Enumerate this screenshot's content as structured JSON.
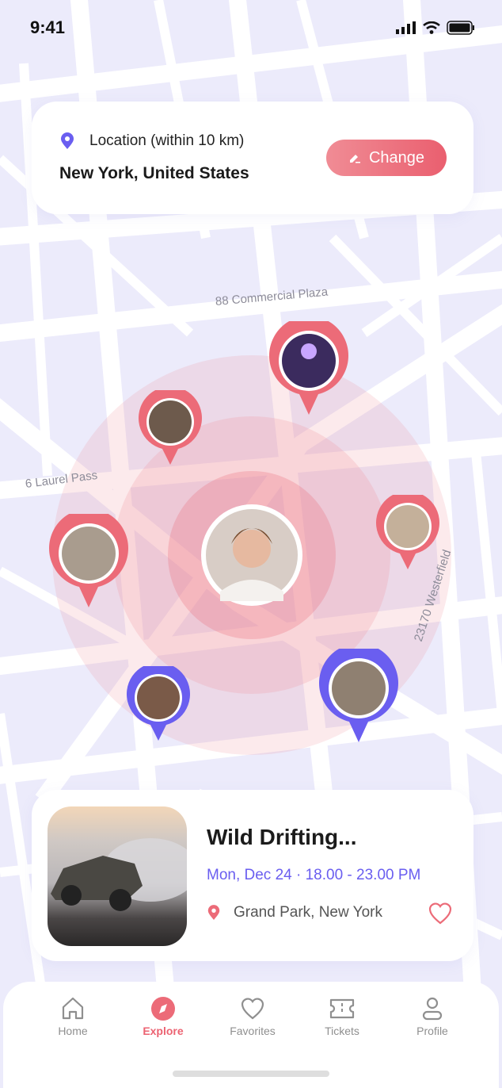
{
  "status_bar": {
    "time": "9:41"
  },
  "location": {
    "label": "Location (within 10 km)",
    "value": "New York, United States",
    "change_label": "Change"
  },
  "map": {
    "streets": [
      "88 Commercial Plaza",
      "6 Laurel Pass",
      "23170 Westerfield"
    ],
    "radius_km": 10
  },
  "event": {
    "title": "Wild Drifting...",
    "datetime": "Mon, Dec 24 · 18.00 - 23.00 PM",
    "place": "Grand Park, New York"
  },
  "nav": [
    {
      "label": "Home"
    },
    {
      "label": "Explore"
    },
    {
      "label": "Favorites"
    },
    {
      "label": "Tickets"
    },
    {
      "label": "Profile"
    }
  ],
  "colors": {
    "accent": "#ea5f6f",
    "secondary": "#6a5ef0",
    "map_bg": "#ecebfb"
  }
}
